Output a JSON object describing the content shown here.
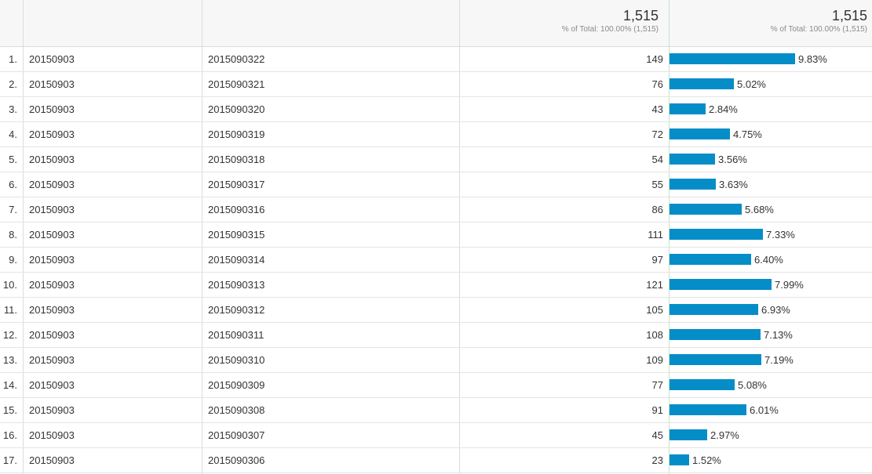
{
  "header": {
    "col_sessions": {
      "total": "1,515",
      "sub": "% of Total: 100.00% (1,515)"
    },
    "col_share": {
      "total": "1,515",
      "sub": "% of Total: 100.00% (1,515)"
    }
  },
  "colors": {
    "bar": "#058dc7"
  },
  "rows": [
    {
      "idx": "1.",
      "date": "20150903",
      "hour": "2015090322",
      "value": "149",
      "pct": "9.83%",
      "fraction": 0.0983
    },
    {
      "idx": "2.",
      "date": "20150903",
      "hour": "2015090321",
      "value": "76",
      "pct": "5.02%",
      "fraction": 0.0502
    },
    {
      "idx": "3.",
      "date": "20150903",
      "hour": "2015090320",
      "value": "43",
      "pct": "2.84%",
      "fraction": 0.0284
    },
    {
      "idx": "4.",
      "date": "20150903",
      "hour": "2015090319",
      "value": "72",
      "pct": "4.75%",
      "fraction": 0.0475
    },
    {
      "idx": "5.",
      "date": "20150903",
      "hour": "2015090318",
      "value": "54",
      "pct": "3.56%",
      "fraction": 0.0356
    },
    {
      "idx": "6.",
      "date": "20150903",
      "hour": "2015090317",
      "value": "55",
      "pct": "3.63%",
      "fraction": 0.0363
    },
    {
      "idx": "7.",
      "date": "20150903",
      "hour": "2015090316",
      "value": "86",
      "pct": "5.68%",
      "fraction": 0.0568
    },
    {
      "idx": "8.",
      "date": "20150903",
      "hour": "2015090315",
      "value": "111",
      "pct": "7.33%",
      "fraction": 0.0733
    },
    {
      "idx": "9.",
      "date": "20150903",
      "hour": "2015090314",
      "value": "97",
      "pct": "6.40%",
      "fraction": 0.064
    },
    {
      "idx": "10.",
      "date": "20150903",
      "hour": "2015090313",
      "value": "121",
      "pct": "7.99%",
      "fraction": 0.0799
    },
    {
      "idx": "11.",
      "date": "20150903",
      "hour": "2015090312",
      "value": "105",
      "pct": "6.93%",
      "fraction": 0.0693
    },
    {
      "idx": "12.",
      "date": "20150903",
      "hour": "2015090311",
      "value": "108",
      "pct": "7.13%",
      "fraction": 0.0713
    },
    {
      "idx": "13.",
      "date": "20150903",
      "hour": "2015090310",
      "value": "109",
      "pct": "7.19%",
      "fraction": 0.0719
    },
    {
      "idx": "14.",
      "date": "20150903",
      "hour": "2015090309",
      "value": "77",
      "pct": "5.08%",
      "fraction": 0.0508
    },
    {
      "idx": "15.",
      "date": "20150903",
      "hour": "2015090308",
      "value": "91",
      "pct": "6.01%",
      "fraction": 0.0601
    },
    {
      "idx": "16.",
      "date": "20150903",
      "hour": "2015090307",
      "value": "45",
      "pct": "2.97%",
      "fraction": 0.0297
    },
    {
      "idx": "17.",
      "date": "20150903",
      "hour": "2015090306",
      "value": "23",
      "pct": "1.52%",
      "fraction": 0.0152
    }
  ]
}
